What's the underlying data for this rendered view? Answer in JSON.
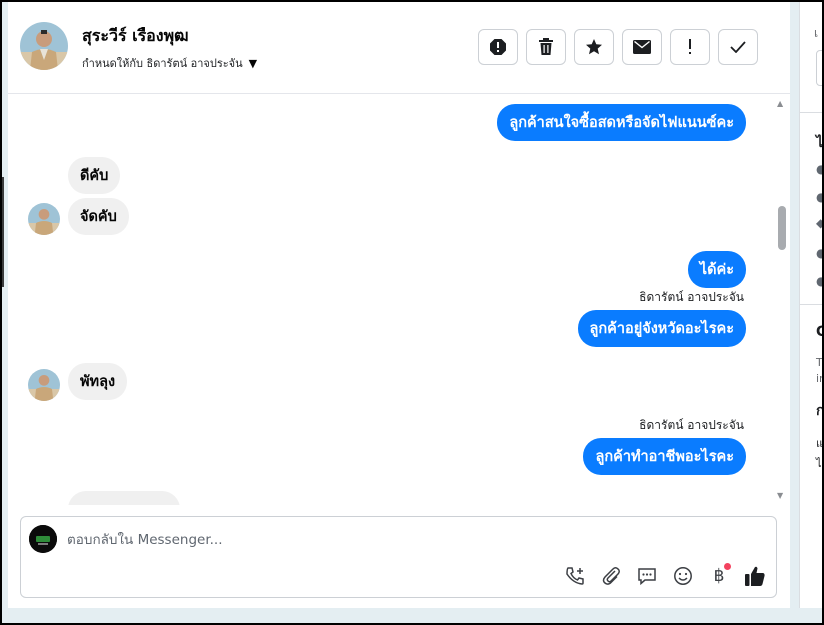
{
  "header": {
    "contact_name": "สุระวีร์ เรืองพุฒ",
    "assigned_to": "กำหนดให้กับ ธิดารัตน์ อาจประจัน",
    "actions": [
      "report-icon",
      "trash-icon",
      "star-icon",
      "mail-icon",
      "exclamation-icon",
      "check-icon"
    ]
  },
  "messages": [
    {
      "dir": "out",
      "text": "ลูกค้าสนใจซื้อสดหรือจัดไฟแนนซ์คะ"
    },
    {
      "dir": "in",
      "text": "ดีคับ"
    },
    {
      "dir": "in",
      "text": "จัดคับ"
    },
    {
      "dir": "out",
      "text": "ได้ค่ะ"
    },
    {
      "dir": "out",
      "sender": "ธิดารัตน์ อาจประจัน",
      "text": "ลูกค้าอยู่จังหวัดอะไรคะ"
    },
    {
      "dir": "in",
      "text": "พัทลุง"
    },
    {
      "dir": "out",
      "sender": "ธิดารัตน์ อาจประจัน",
      "text": "ลูกค้าทำอาชีพอะไรคะ"
    }
  ],
  "composer": {
    "placeholder": "ตอบกลับใน Messenger...",
    "tools": [
      "phone-add-icon",
      "attachment-icon",
      "saved-reply-icon",
      "emoji-icon",
      "baht-icon",
      "like-icon"
    ]
  },
  "right_panel": {
    "fragments": [
      "เ",
      "ไ",
      "C",
      "T",
      "in",
      "ก",
      "แ",
      "ไ"
    ]
  },
  "colors": {
    "outgoing_bubble": "#0a7cff",
    "incoming_bubble": "#f0f0f0",
    "notification_dot": "#f3425f"
  }
}
